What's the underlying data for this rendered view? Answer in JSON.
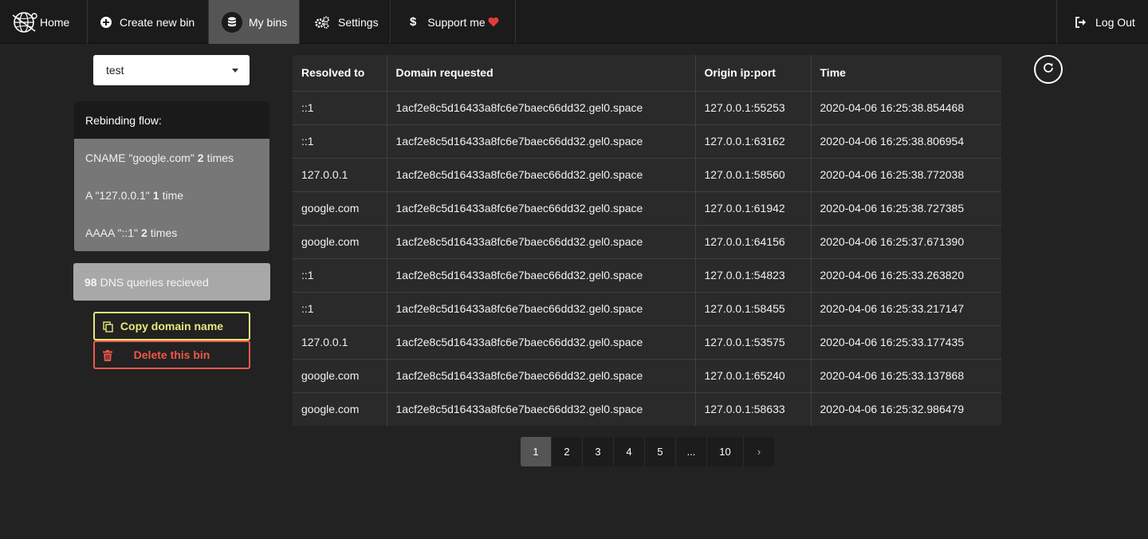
{
  "nav": {
    "home": "Home",
    "create": "Create new bin",
    "mybins": "My bins",
    "settings": "Settings",
    "support": "Support me",
    "logout": "Log Out"
  },
  "bin_select": {
    "value": "test"
  },
  "flow": {
    "title": "Rebinding flow:",
    "items": [
      {
        "prefix": "CNAME \"google.com\"",
        "count": "2",
        "suffix": "times"
      },
      {
        "prefix": "A \"127.0.0.1\"",
        "count": "1",
        "suffix": "time"
      },
      {
        "prefix": "AAAA \"::1\"",
        "count": "2",
        "suffix": "times"
      }
    ]
  },
  "queries": {
    "count": "98",
    "text": "DNS queries recieved"
  },
  "buttons": {
    "copy": "Copy domain name",
    "delete": "Delete this bin"
  },
  "table": {
    "headers": [
      "Resolved to",
      "Domain requested",
      "Origin ip:port",
      "Time"
    ],
    "rows": [
      [
        "::1",
        "1acf2e8c5d16433a8fc6e7baec66dd32.gel0.space",
        "127.0.0.1:55253",
        "2020-04-06 16:25:38.854468"
      ],
      [
        "::1",
        "1acf2e8c5d16433a8fc6e7baec66dd32.gel0.space",
        "127.0.0.1:63162",
        "2020-04-06 16:25:38.806954"
      ],
      [
        "127.0.0.1",
        "1acf2e8c5d16433a8fc6e7baec66dd32.gel0.space",
        "127.0.0.1:58560",
        "2020-04-06 16:25:38.772038"
      ],
      [
        "google.com",
        "1acf2e8c5d16433a8fc6e7baec66dd32.gel0.space",
        "127.0.0.1:61942",
        "2020-04-06 16:25:38.727385"
      ],
      [
        "google.com",
        "1acf2e8c5d16433a8fc6e7baec66dd32.gel0.space",
        "127.0.0.1:64156",
        "2020-04-06 16:25:37.671390"
      ],
      [
        "::1",
        "1acf2e8c5d16433a8fc6e7baec66dd32.gel0.space",
        "127.0.0.1:54823",
        "2020-04-06 16:25:33.263820"
      ],
      [
        "::1",
        "1acf2e8c5d16433a8fc6e7baec66dd32.gel0.space",
        "127.0.0.1:58455",
        "2020-04-06 16:25:33.217147"
      ],
      [
        "127.0.0.1",
        "1acf2e8c5d16433a8fc6e7baec66dd32.gel0.space",
        "127.0.0.1:53575",
        "2020-04-06 16:25:33.177435"
      ],
      [
        "google.com",
        "1acf2e8c5d16433a8fc6e7baec66dd32.gel0.space",
        "127.0.0.1:65240",
        "2020-04-06 16:25:33.137868"
      ],
      [
        "google.com",
        "1acf2e8c5d16433a8fc6e7baec66dd32.gel0.space",
        "127.0.0.1:58633",
        "2020-04-06 16:25:32.986479"
      ]
    ]
  },
  "pagination": {
    "pages": [
      "1",
      "2",
      "3",
      "4",
      "5",
      "...",
      "10",
      "›"
    ],
    "active": "1"
  },
  "colors": {
    "background": "#222222",
    "nav_active": "#555555",
    "copy_accent": "#e6ea7b",
    "delete_accent": "#f1574a",
    "heart": "#e23b3b"
  },
  "icons": {
    "home": "globe-logo-icon",
    "create": "plus-circle-icon",
    "mybins": "database-icon",
    "settings": "gears-icon",
    "support": "dollar-icon",
    "logout": "sign-out-icon",
    "copy": "copy-icon",
    "delete": "trash-icon",
    "refresh": "refresh-icon"
  }
}
